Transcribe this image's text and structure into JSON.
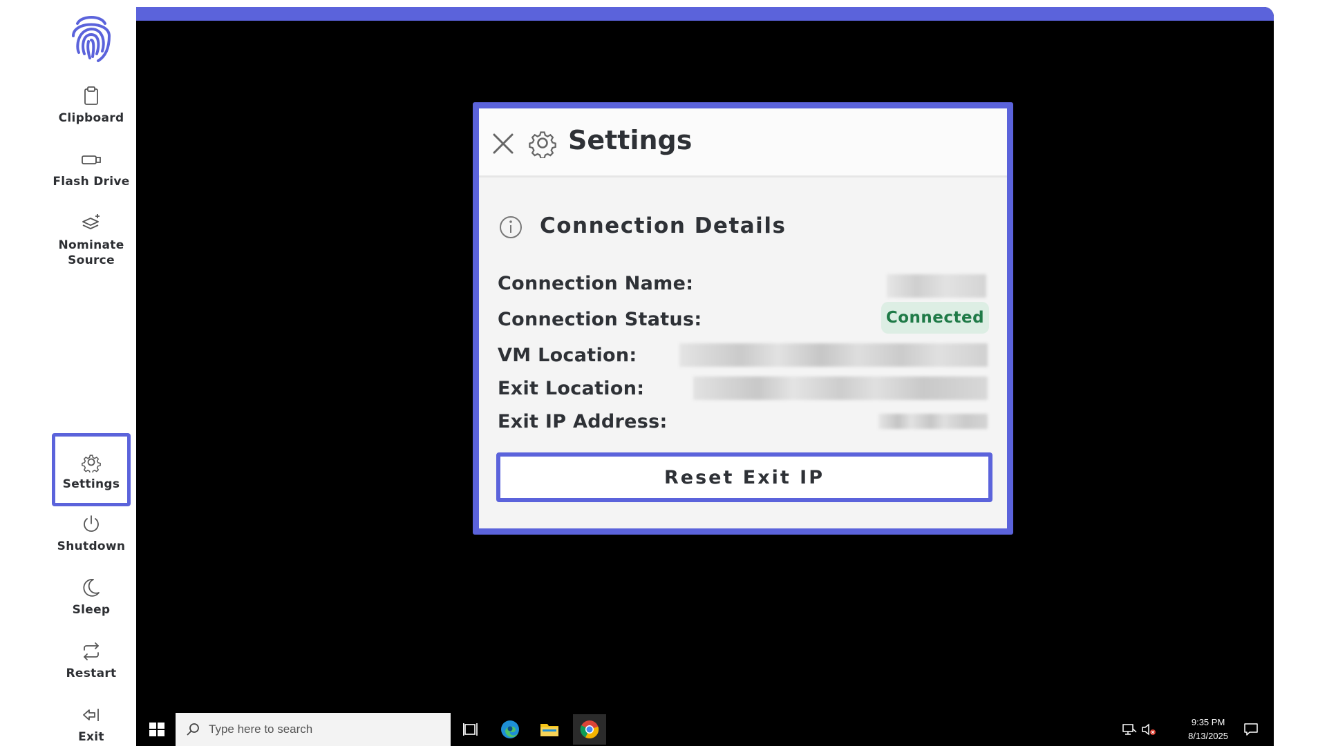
{
  "sidebar": {
    "items": [
      {
        "label": "Clipboard",
        "icon": "clipboard-icon"
      },
      {
        "label": "Flash Drive",
        "icon": "flash-drive-icon"
      },
      {
        "label": "Nominate\nSource",
        "icon": "nominate-source-icon"
      },
      {
        "label": "Settings",
        "icon": "gear-icon"
      },
      {
        "label": "Shutdown",
        "icon": "power-icon"
      },
      {
        "label": "Sleep",
        "icon": "moon-icon"
      },
      {
        "label": "Restart",
        "icon": "restart-icon"
      },
      {
        "label": "Exit",
        "icon": "exit-icon"
      }
    ],
    "active_item": "Settings"
  },
  "dialog": {
    "title": "Settings",
    "section_title": "Connection Details",
    "rows": {
      "connection_name_label": "Connection Name:",
      "connection_status_label": "Connection Status:",
      "connection_status_value": "Connected",
      "vm_location_label": "VM Location:",
      "exit_location_label": "Exit Location:",
      "exit_ip_label": "Exit IP Address:"
    },
    "reset_button": "Reset Exit IP"
  },
  "taskbar": {
    "search_placeholder": "Type here to search",
    "time": "9:35 PM",
    "date": "8/13/2025"
  },
  "colors": {
    "accent": "#5b63db",
    "status_bg": "#ddeee4",
    "status_text": "#1f7a47"
  }
}
